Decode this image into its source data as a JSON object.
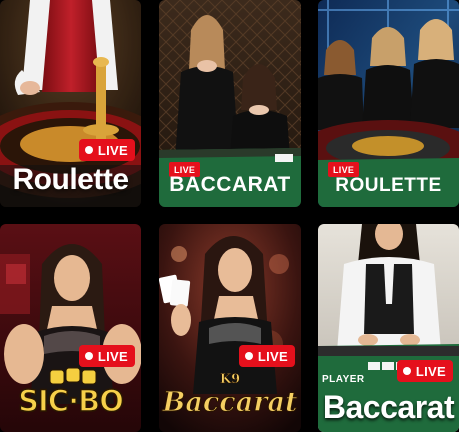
{
  "tiles": [
    {
      "title": "Roulette",
      "badge": "LIVE"
    },
    {
      "title": "BACCARAT",
      "badge": "LIVE"
    },
    {
      "title": "ROULETTE",
      "badge": "LIVE"
    },
    {
      "logo": "SIC·BO",
      "badge": "LIVE"
    },
    {
      "logo": "Baccarat",
      "logo_sub": "K9",
      "badge": "LIVE"
    },
    {
      "title": "Baccarat",
      "badge": "LIVE",
      "table_text": "PLAYER"
    }
  ],
  "colors": {
    "live_badge": "#e5101c",
    "green_table": "#1f6b3c",
    "gold": "#f5cf62"
  }
}
